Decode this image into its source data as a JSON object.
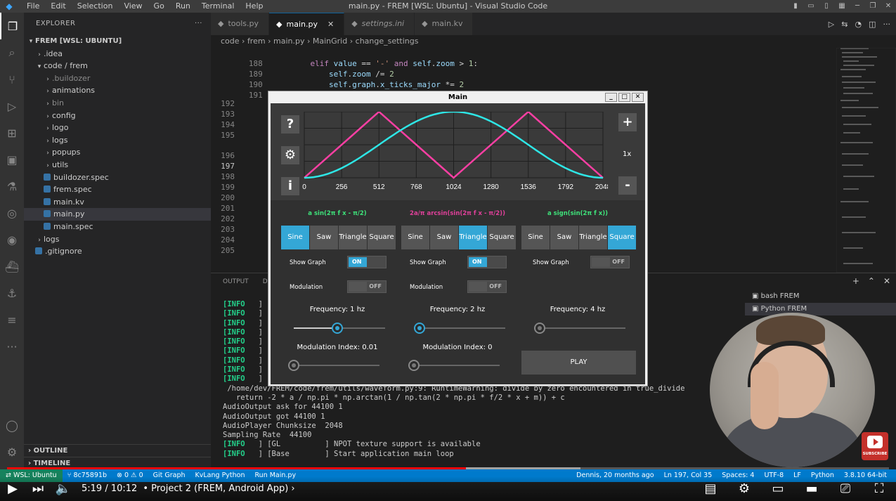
{
  "window": {
    "title": "main.py - FREM [WSL: Ubuntu] - Visual Studio Code",
    "menu": [
      "File",
      "Edit",
      "Selection",
      "View",
      "Go",
      "Run",
      "Terminal",
      "Help"
    ]
  },
  "sidebar": {
    "header": "EXPLORER",
    "root": "FREM [WSL: UBUNTU]",
    "items": [
      {
        "label": ".idea",
        "indent": 1,
        "type": "folder",
        "open": false
      },
      {
        "label": "code / frem",
        "indent": 1,
        "type": "folder",
        "open": true
      },
      {
        "label": ".buildozer",
        "indent": 2,
        "type": "folder",
        "open": false,
        "muted": true
      },
      {
        "label": "animations",
        "indent": 2,
        "type": "folder",
        "open": false
      },
      {
        "label": "bin",
        "indent": 2,
        "type": "folder",
        "open": false,
        "muted": true
      },
      {
        "label": "config",
        "indent": 2,
        "type": "folder",
        "open": false
      },
      {
        "label": "logo",
        "indent": 2,
        "type": "folder",
        "open": false
      },
      {
        "label": "logs",
        "indent": 2,
        "type": "folder",
        "open": false
      },
      {
        "label": "popups",
        "indent": 2,
        "type": "folder",
        "open": false
      },
      {
        "label": "utils",
        "indent": 2,
        "type": "folder",
        "open": false
      },
      {
        "label": "buildozer.spec",
        "indent": 2,
        "type": "file"
      },
      {
        "label": "frem.spec",
        "indent": 2,
        "type": "file"
      },
      {
        "label": "main.kv",
        "indent": 2,
        "type": "file"
      },
      {
        "label": "main.py",
        "indent": 2,
        "type": "file",
        "selected": true
      },
      {
        "label": "main.spec",
        "indent": 2,
        "type": "file"
      },
      {
        "label": "logs",
        "indent": 1,
        "type": "folder",
        "open": false
      },
      {
        "label": ".gitignore",
        "indent": 1,
        "type": "file"
      }
    ],
    "outline": "OUTLINE",
    "timeline": "TIMELINE"
  },
  "tabs": [
    {
      "label": "tools.py",
      "active": false,
      "italic": false
    },
    {
      "label": "main.py",
      "active": true,
      "italic": false
    },
    {
      "label": "settings.ini",
      "active": false,
      "italic": true
    },
    {
      "label": "main.kv",
      "active": false,
      "italic": false
    }
  ],
  "breadcrumb": [
    "code",
    "frem",
    "main.py",
    "MainGrid",
    "change_settings"
  ],
  "editor": {
    "lines": [
      {
        "n": "188",
        "code": "elif value == '-' and self.zoom > 1:"
      },
      {
        "n": "189",
        "code": "    self.zoom /= 2"
      },
      {
        "n": "190",
        "code": "    self.graph.x_ticks_major *= 2"
      },
      {
        "n": "191",
        "code": ""
      },
      {
        "n": "192",
        "code": ""
      },
      {
        "n": "193",
        "code": ""
      },
      {
        "n": "194",
        "code": ""
      },
      {
        "n": "195",
        "code": ""
      },
      {
        "n": "196",
        "code": ""
      },
      {
        "n": "197",
        "code": ""
      },
      {
        "n": "198",
        "code": ""
      },
      {
        "n": "199",
        "code": ""
      },
      {
        "n": "200",
        "code": ""
      },
      {
        "n": "201",
        "code": ""
      },
      {
        "n": "202",
        "code": ""
      },
      {
        "n": "203",
        "code": ""
      },
      {
        "n": "204",
        "code": ""
      },
      {
        "n": "205",
        "code": ""
      }
    ]
  },
  "panel": {
    "tabs": [
      "OUTPUT",
      "DE"
    ],
    "terminal_lines": [
      {
        "info": "[INFO",
        "rest": "   ] ["
      },
      {
        "info": "[INFO",
        "rest": "   ] ["
      },
      {
        "info": "[INFO",
        "rest": "   ] ["
      },
      {
        "info": "[INFO",
        "rest": "   ] ["
      },
      {
        "info": "[INFO",
        "rest": "   ] ["
      },
      {
        "info": "[INFO",
        "rest": "   ] ["
      },
      {
        "info": "[INFO",
        "rest": "   ] ["
      },
      {
        "info": "[INFO",
        "rest": "   ] ["
      },
      {
        "info": "[INFO",
        "rest": "   ] ["
      },
      {
        "info": "",
        "rest": " /home/dev/FREM/code/frem/utils/waveform.py:9: RuntimeWarning: divide by zero encountered in true_divide"
      },
      {
        "info": "",
        "rest": "   return -2 * a / np.pi * np.arctan(1 / np.tan(2 * np.pi * f/2 * x + m)) + c"
      },
      {
        "info": "",
        "rest": "AudioOutput ask for 44100 1"
      },
      {
        "info": "",
        "rest": "AudioOutput got 44100 1"
      },
      {
        "info": "",
        "rest": "AudioPlayer Chunksize  2048"
      },
      {
        "info": "",
        "rest": "Sampling Rate  44100"
      },
      {
        "info": "[INFO",
        "rest": "   ] [GL          ] NPOT texture support is available"
      },
      {
        "info": "[INFO",
        "rest": "   ] [Base        ] Start application main loop"
      }
    ],
    "terminals": [
      "bash FREM",
      "Python FREM"
    ]
  },
  "statusbar": {
    "remote": "WSL: Ubuntu",
    "branch": "8c75891b",
    "problems": "0 ⚠ 0",
    "left_items": [
      "Git Graph",
      "KvLang Python",
      "Run Main.py"
    ],
    "right_items": [
      "Dennis, 20 months ago",
      "Ln 197, Col 35",
      "Spaces: 4",
      "UTF-8",
      "LF",
      "Python",
      "3.8.10 64-bit"
    ]
  },
  "app": {
    "title": "Main",
    "help_btn": "?",
    "info_btn": "i",
    "zoom_in": "+",
    "zoom_out": "-",
    "zoom_level": "1x",
    "colors": {
      "wave1": "#ff3fa4",
      "wave2": "#2ee6e6",
      "accent": "#34a7d6"
    },
    "columns": [
      {
        "formula": "a sin(2π f x - π/2)",
        "color": "#3ee27a",
        "waves": [
          "Sine",
          "Saw",
          "Triangle",
          "Square"
        ],
        "selected": 0,
        "show_graph_label": "Show Graph",
        "show_graph": "ON",
        "modulation_label": "Modulation",
        "modulation": "OFF",
        "frequency_label": "Frequency: 1 hz",
        "frequency_fraction": 0.47,
        "mod_index_label": "Modulation Index: 0.01",
        "mod_index_fraction": 0.0
      },
      {
        "formula": "2a/π arcsin(sin(2π f x - π/2))",
        "color": "#e0409a",
        "waves": [
          "Sine",
          "Saw",
          "Triangle",
          "Square"
        ],
        "selected": 2,
        "show_graph_label": "Show Graph",
        "show_graph": "ON",
        "modulation_label": "Modulation",
        "modulation": "OFF",
        "frequency_label": "Frequency: 2 hz",
        "frequency_fraction": 0.0,
        "mod_index_label": "Modulation Index: 0",
        "mod_index_fraction": 0.0
      },
      {
        "formula": "a sign(sin(2π f x))",
        "color": "#3ee27a",
        "waves": [
          "Sine",
          "Saw",
          "Triangle",
          "Square"
        ],
        "selected": 3,
        "show_graph_label": "Show Graph",
        "show_graph": "OFF",
        "modulation_label": "",
        "modulation": "",
        "frequency_label": "Frequency: 4 hz",
        "frequency_fraction": 0.0,
        "mod_index_label": "",
        "mod_index_fraction": null
      }
    ],
    "play_label": "PLAY"
  },
  "chart_data": {
    "type": "line",
    "x": [
      0,
      256,
      512,
      768,
      1024,
      1280,
      1536,
      1792,
      2048
    ],
    "x_ticks": [
      "0",
      "256",
      "512",
      "768",
      "1024",
      "1280",
      "1536",
      "1792",
      "2048"
    ],
    "xlim": [
      0,
      2048
    ],
    "ylim": [
      -1,
      1
    ],
    "grid": true,
    "series": [
      {
        "color": "#ff3fa4",
        "x": [
          0,
          512,
          1024,
          1536,
          2048
        ],
        "values": [
          -1,
          1,
          -1,
          1,
          -1
        ]
      },
      {
        "color": "#2ee6e6",
        "x": [
          0,
          256,
          512,
          768,
          1024,
          1280,
          1536,
          1792,
          2048
        ],
        "values": [
          -1,
          -0.707,
          0,
          0.707,
          1,
          0.707,
          0,
          -0.707,
          -1
        ]
      }
    ]
  },
  "video": {
    "time": "5:19 / 10:12",
    "chapter": "Project 2 (FREM, Android App)",
    "played_fraction": 0.52,
    "buffered_fraction": 0.65,
    "subscribe": "SUBSCRIBE"
  }
}
